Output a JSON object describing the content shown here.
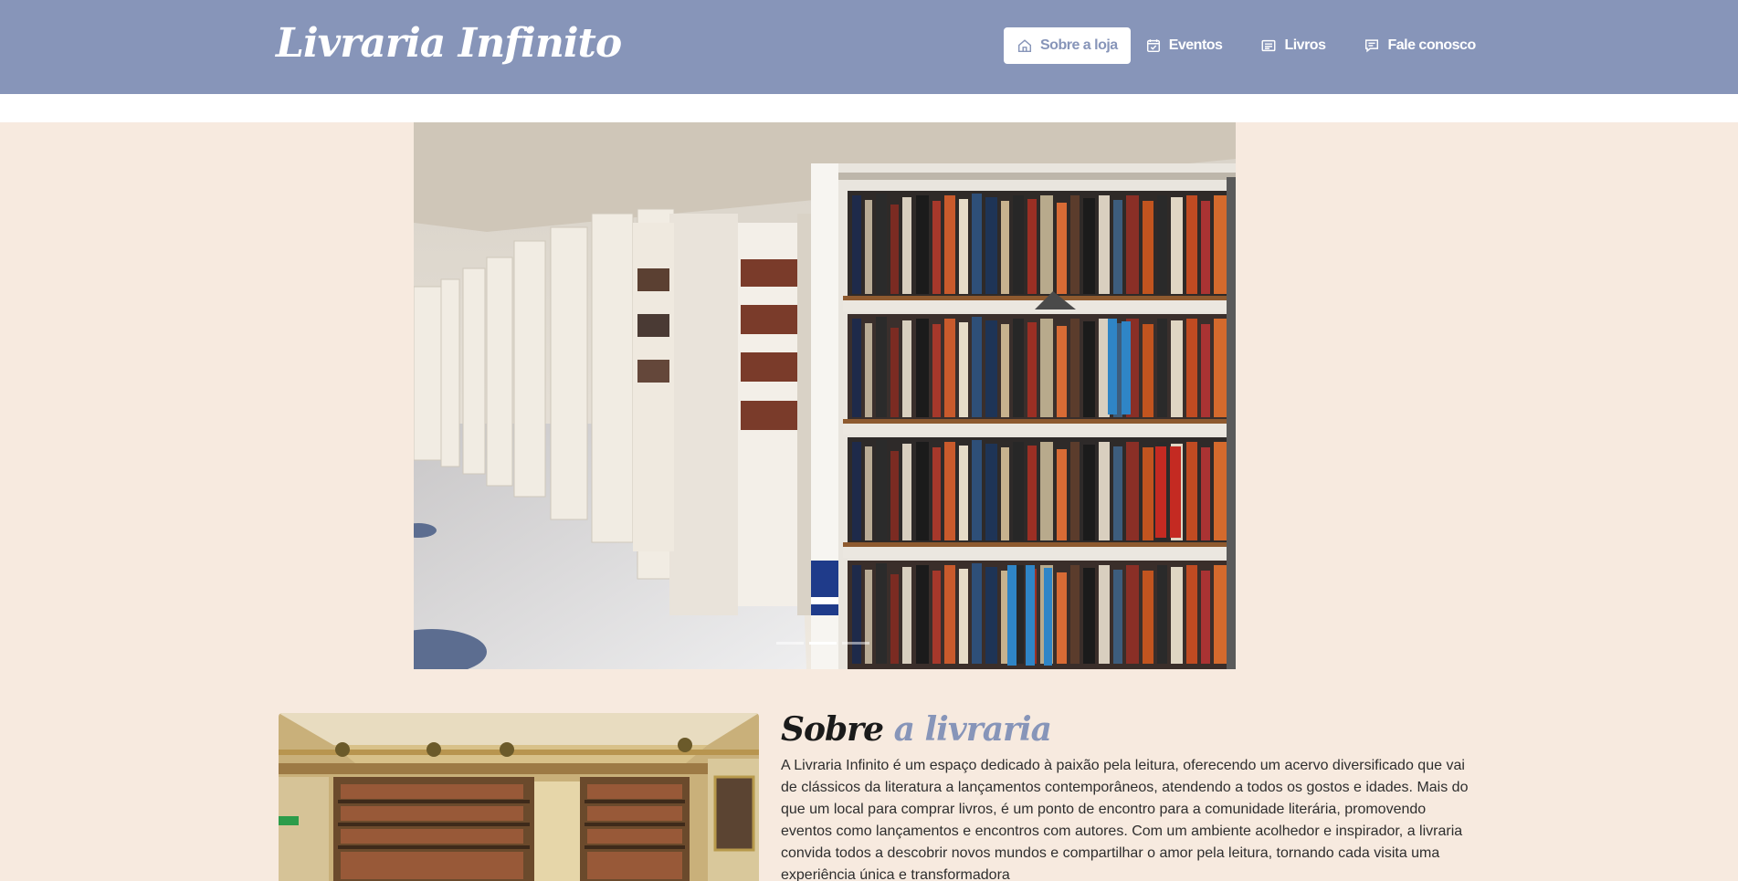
{
  "header": {
    "brand": "Livraria Infinito",
    "nav": [
      {
        "label": "Sobre a loja",
        "icon": "home-icon",
        "active": true
      },
      {
        "label": "Eventos",
        "icon": "calendar-check-icon",
        "active": false
      },
      {
        "label": "Livros",
        "icon": "list-icon",
        "active": false
      },
      {
        "label": "Fale conosco",
        "icon": "chat-icon",
        "active": false
      }
    ]
  },
  "carousel": {
    "slides": 3,
    "active_slide": 2
  },
  "about": {
    "title_part1": "Sobre",
    "title_part2": "a livraria",
    "text": "A Livraria Infinito é um espaço dedicado à paixão pela leitura, oferecendo um acervo diversificado que vai de clássicos da literatura a lançamentos contemporâneos, atendendo a todos os gostos e idades. Mais do que um local para comprar livros, é um ponto de encontro para a comunidade literária, promovendo eventos como lançamentos e encontros com autores. Com um ambiente acolhedor e inspirador, a livraria convida todos a descobrir novos mundos e compartilhar o amor pela leitura, tornando cada visita uma experiência única e transformadora"
  },
  "colors": {
    "header": "#8795b9",
    "background": "#f7eadf",
    "accent": "#8795b9"
  }
}
